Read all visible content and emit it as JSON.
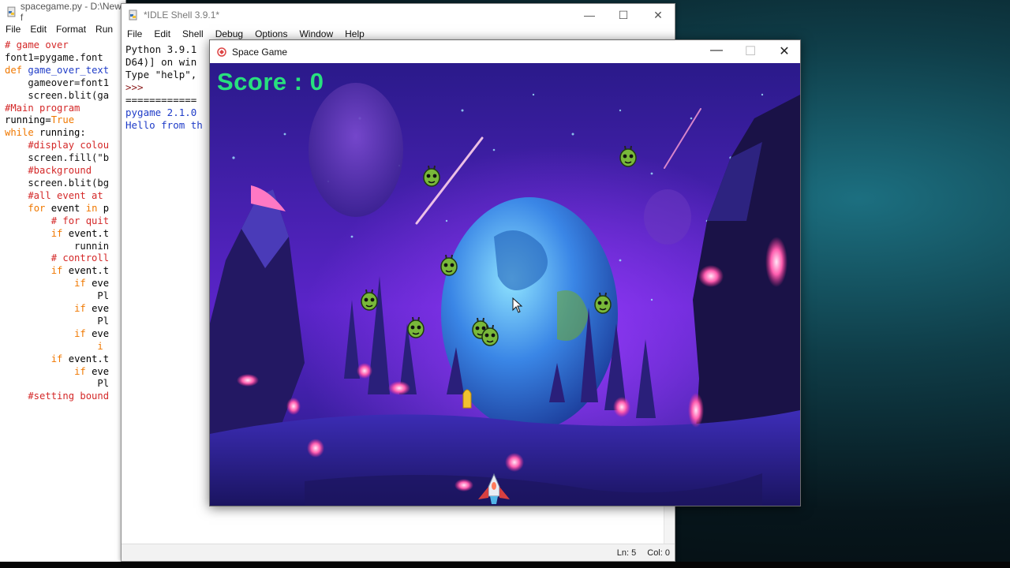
{
  "editor": {
    "title": "spacegame.py - D:\\New f",
    "menu": [
      "File",
      "Edit",
      "Format",
      "Run"
    ],
    "code_lines": [
      {
        "text": "# game over",
        "kind": "comment"
      },
      {
        "text": "font1=pygame.font",
        "kind": "norm"
      },
      {
        "text": "",
        "kind": "norm"
      },
      {
        "text": "def game_over_text",
        "kind": "def"
      },
      {
        "text": "    gameover=font1",
        "kind": "norm"
      },
      {
        "text": "    screen.blit(ga",
        "kind": "norm"
      },
      {
        "text": "",
        "kind": "norm"
      },
      {
        "text": "#Main program",
        "kind": "comment"
      },
      {
        "text": "running=True",
        "kind": "kwtail"
      },
      {
        "text": "while running:",
        "kind": "kwhead"
      },
      {
        "text": "    #display colou",
        "kind": "comment"
      },
      {
        "text": "    screen.fill(\"b",
        "kind": "norm"
      },
      {
        "text": "",
        "kind": "norm"
      },
      {
        "text": "    #background",
        "kind": "comment"
      },
      {
        "text": "    screen.blit(bg",
        "kind": "norm"
      },
      {
        "text": "",
        "kind": "norm"
      },
      {
        "text": "    #all event at",
        "kind": "comment"
      },
      {
        "text": "    for event in p",
        "kind": "kwhead"
      },
      {
        "text": "",
        "kind": "norm"
      },
      {
        "text": "        # for quit",
        "kind": "comment"
      },
      {
        "text": "        if event.t",
        "kind": "kwhead"
      },
      {
        "text": "            runnin",
        "kind": "norm"
      },
      {
        "text": "",
        "kind": "norm"
      },
      {
        "text": "        # controll",
        "kind": "comment"
      },
      {
        "text": "        if event.t",
        "kind": "kwhead"
      },
      {
        "text": "            if eve",
        "kind": "kwhead"
      },
      {
        "text": "                Pl",
        "kind": "norm"
      },
      {
        "text": "            if eve",
        "kind": "kwhead"
      },
      {
        "text": "                Pl",
        "kind": "norm"
      },
      {
        "text": "            if eve",
        "kind": "kwhead"
      },
      {
        "text": "                i",
        "kind": "kwhead"
      },
      {
        "text": "",
        "kind": "norm"
      },
      {
        "text": "",
        "kind": "norm"
      },
      {
        "text": "",
        "kind": "norm"
      },
      {
        "text": "",
        "kind": "norm"
      },
      {
        "text": "        if event.t",
        "kind": "kwhead"
      },
      {
        "text": "            if eve",
        "kind": "kwhead"
      },
      {
        "text": "                Pl",
        "kind": "norm"
      },
      {
        "text": "",
        "kind": "norm"
      },
      {
        "text": "    #setting bound",
        "kind": "comment"
      }
    ]
  },
  "shell": {
    "title": "*IDLE Shell 3.9.1*",
    "menu": [
      "File",
      "Edit",
      "Shell",
      "Debug",
      "Options",
      "Window",
      "Help"
    ],
    "lines": [
      {
        "text": "Python 3.9.1",
        "kind": "out"
      },
      {
        "text": "D64)] on win",
        "kind": "out"
      },
      {
        "text": "Type \"help\",",
        "kind": "out"
      },
      {
        "text": ">>>",
        "kind": "prompt"
      },
      {
        "text": "============",
        "kind": "out"
      },
      {
        "text": "pygame 2.1.0",
        "kind": "blue"
      },
      {
        "text": "Hello from th",
        "kind": "blue"
      }
    ],
    "status_line": "Ln: 5",
    "status_col": "Col: 0"
  },
  "game": {
    "title": "Space Game",
    "score_label": "Score : 0"
  },
  "colors": {
    "score": "#28e07e",
    "comment": "#d42828",
    "keyword": "#f07800",
    "defname": "#1f3cc8",
    "sky_top": "#2a1a8a",
    "sky_glow": "#7a2be0",
    "planet": "#3a86e6",
    "crystal": "#ff5fb0",
    "alien": "#79b83a"
  },
  "icons": {
    "editor": "python-file-icon",
    "shell": "python-shell-icon",
    "game": "pygame-icon",
    "player": "spaceship-icon",
    "enemy": "alien-icon",
    "bullet": "bullet-icon",
    "cursor": "mouse-cursor-icon"
  }
}
